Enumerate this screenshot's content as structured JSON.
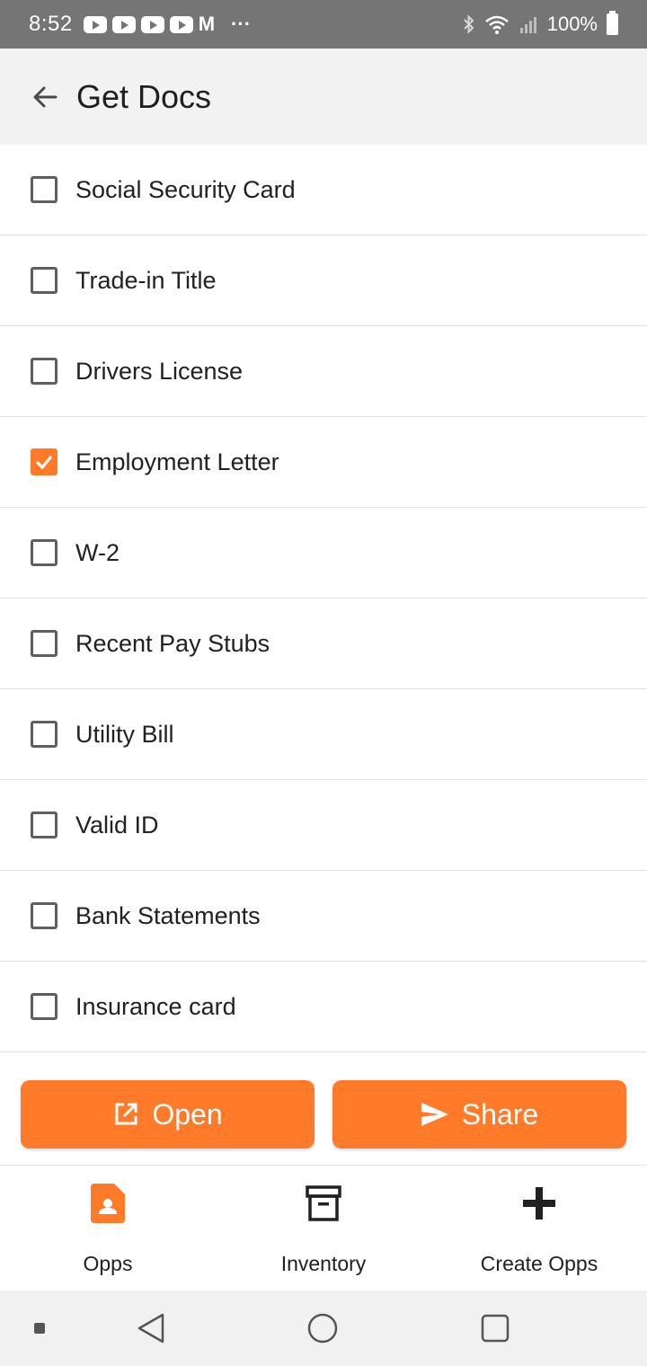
{
  "status_bar": {
    "time": "8:52",
    "battery": "100%",
    "notification_icons": [
      "youtube-icon",
      "youtube-icon",
      "youtube-icon",
      "youtube-icon",
      "gmail-icon",
      "more-dots-icon"
    ]
  },
  "header": {
    "title": "Get Docs",
    "back_icon": "arrow-back-icon"
  },
  "documents": [
    {
      "label": "Social Security Card",
      "checked": false
    },
    {
      "label": "Trade-in Title",
      "checked": false
    },
    {
      "label": "Drivers License",
      "checked": false
    },
    {
      "label": "Employment Letter",
      "checked": true
    },
    {
      "label": "W-2",
      "checked": false
    },
    {
      "label": "Recent Pay Stubs",
      "checked": false
    },
    {
      "label": "Utility Bill",
      "checked": false
    },
    {
      "label": "Valid ID",
      "checked": false
    },
    {
      "label": "Bank Statements",
      "checked": false
    },
    {
      "label": "Insurance card",
      "checked": false
    }
  ],
  "actions": {
    "open_label": "Open",
    "share_label": "Share"
  },
  "bottom_nav": {
    "items": [
      {
        "label": "Opps",
        "icon": "contact-document-icon",
        "active": true
      },
      {
        "label": "Inventory",
        "icon": "archive-box-icon",
        "active": false
      },
      {
        "label": "Create Opps",
        "icon": "plus-icon",
        "active": false
      }
    ]
  },
  "colors": {
    "accent": "#ff7b29",
    "status_bar": "#757575",
    "app_bar": "#f2f2f2",
    "divider": "#e3e3e3"
  }
}
